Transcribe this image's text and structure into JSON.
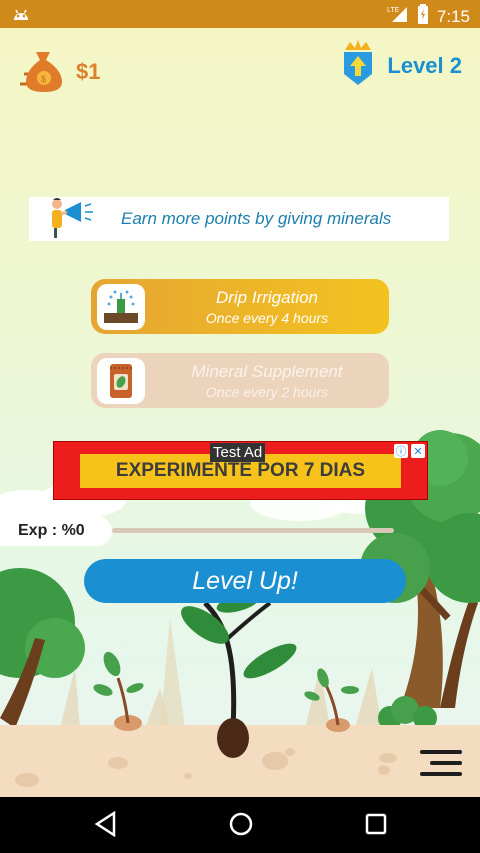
{
  "status_bar": {
    "network": "LTE",
    "time": "7:15"
  },
  "header": {
    "money": "$1",
    "level": "Level 2"
  },
  "tip_banner": {
    "text": "Earn more points by giving minerals"
  },
  "upgrades": [
    {
      "title": "Drip Irrigation",
      "subtitle": "Once every 4 hours"
    },
    {
      "title": "Mineral Supplement",
      "subtitle": "Once every 2 hours"
    }
  ],
  "ad": {
    "label": "Test Ad",
    "text": "EXPERIMENTE POR 7 DIAS"
  },
  "progress": {
    "exp_label": "Exp : %0",
    "exp_percent": 0
  },
  "actions": {
    "level_up": "Level Up!"
  },
  "colors": {
    "accent": "#1a8fd1",
    "status_bar": "#d08a1a",
    "money": "#d9822b"
  },
  "icons": [
    "android-icon",
    "signal-icon",
    "battery-icon",
    "money-bag-icon",
    "level-badge-icon",
    "megaphone-icon",
    "drip-irrigation-icon",
    "mineral-bag-icon",
    "adchoices-icon",
    "close-icon",
    "menu-icon",
    "back-icon",
    "home-icon",
    "recents-icon"
  ]
}
